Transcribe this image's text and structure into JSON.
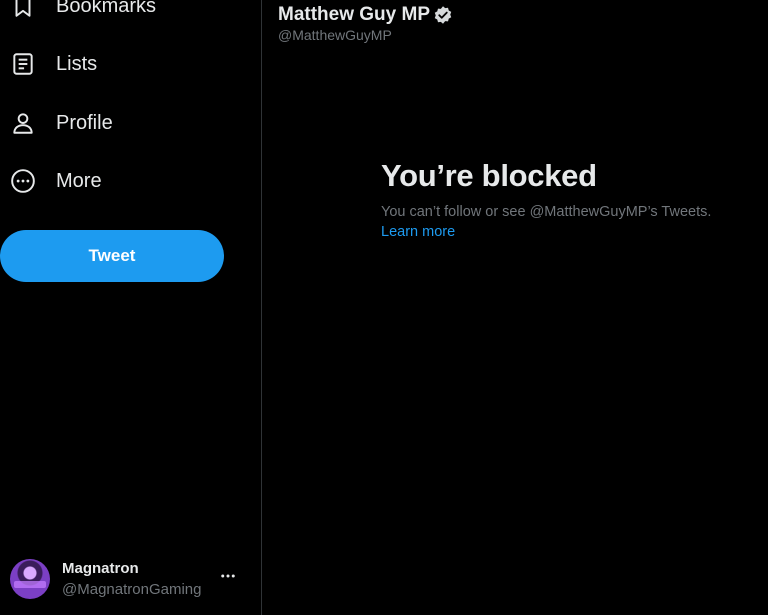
{
  "sidebar": {
    "items": [
      {
        "label": "Bookmarks",
        "icon": "bookmark-icon"
      },
      {
        "label": "Lists",
        "icon": "lists-icon"
      },
      {
        "label": "Profile",
        "icon": "profile-icon"
      },
      {
        "label": "More",
        "icon": "more-circle-icon"
      }
    ],
    "tweet_button": "Tweet",
    "account": {
      "name": "Magnatron",
      "handle": "@MagnatronGaming",
      "more_icon": "ellipsis-icon"
    }
  },
  "profile": {
    "name": "Matthew Guy MP",
    "handle": "@MatthewGuyMP",
    "verified": true
  },
  "blocked": {
    "title": "You’re blocked",
    "description": "You can’t follow or see @MatthewGuyMP’s Tweets.",
    "link": "Learn more"
  },
  "colors": {
    "background": "#000000",
    "accent": "#1d9bf0",
    "text_primary": "#e7e9ea",
    "text_secondary": "#71767b",
    "divider": "#2f3336"
  }
}
